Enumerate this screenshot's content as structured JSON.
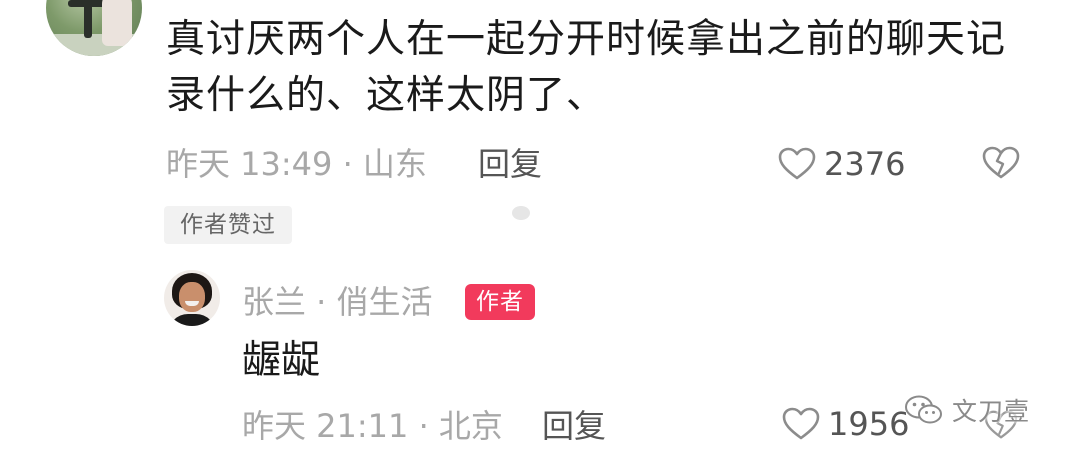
{
  "comment": {
    "text": "真讨厌两个人在一起分开时候拿出之前的聊天记录什么的、这样太阴了、",
    "meta": "昨天 13:49 · 山东",
    "reply_label": "回复",
    "like_count": "2376",
    "author_liked_badge": "作者赞过"
  },
  "reply": {
    "author_name": "张兰 · 俏生活",
    "author_tag": "作者",
    "text": "龌龊",
    "meta": "昨天 21:11 · 北京",
    "reply_label": "回复",
    "like_count": "1956"
  },
  "watermark": {
    "text": "文刀壹"
  },
  "icons": {
    "like": "heart-outline-icon",
    "dislike": "broken-heart-icon",
    "watermark": "wechat-icon"
  },
  "colors": {
    "author_tag_bg": "#f23a5c",
    "meta_text": "#a8a8a8",
    "body_text": "#1a1a1a"
  }
}
